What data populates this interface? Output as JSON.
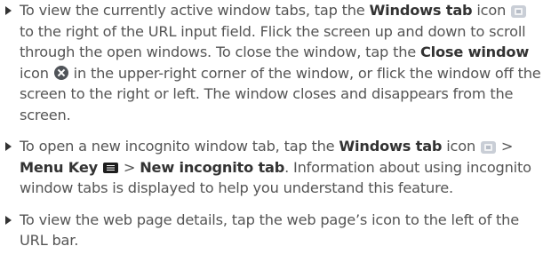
{
  "bullets": [
    {
      "p1": "To view the currently active window tabs, tap the ",
      "b1": "Windows tab",
      "p2": " icon ",
      "p3": " to the right of the URL input field. Flick the screen up and down to scroll through the open windows. To close the window, tap the ",
      "b2": "Close window",
      "p4": " icon ",
      "p5": " in the upper-right corner of the window, or flick the window off the screen to the right or left. The window closes and disappears from the screen."
    },
    {
      "p1": "To open a new incognito window tab, tap the ",
      "b1": "Windows tab",
      "p2": " icon ",
      "p3": " > ",
      "b2": "Menu Key",
      "p4": " > ",
      "b3": "New incognito tab",
      "p5": ". Information about using incognito window tabs is displayed to help you understand this feature."
    },
    {
      "p1": "To view the web page details, tap the web page’s icon to the left of the URL bar."
    }
  ],
  "icons": {
    "bullet": "triangle-bullet-icon",
    "windows_tab": "windows-tab-icon",
    "close_window": "close-window-icon",
    "menu_key": "menu-key-icon"
  },
  "colors": {
    "text": "#555555",
    "bold_text": "#333333"
  }
}
